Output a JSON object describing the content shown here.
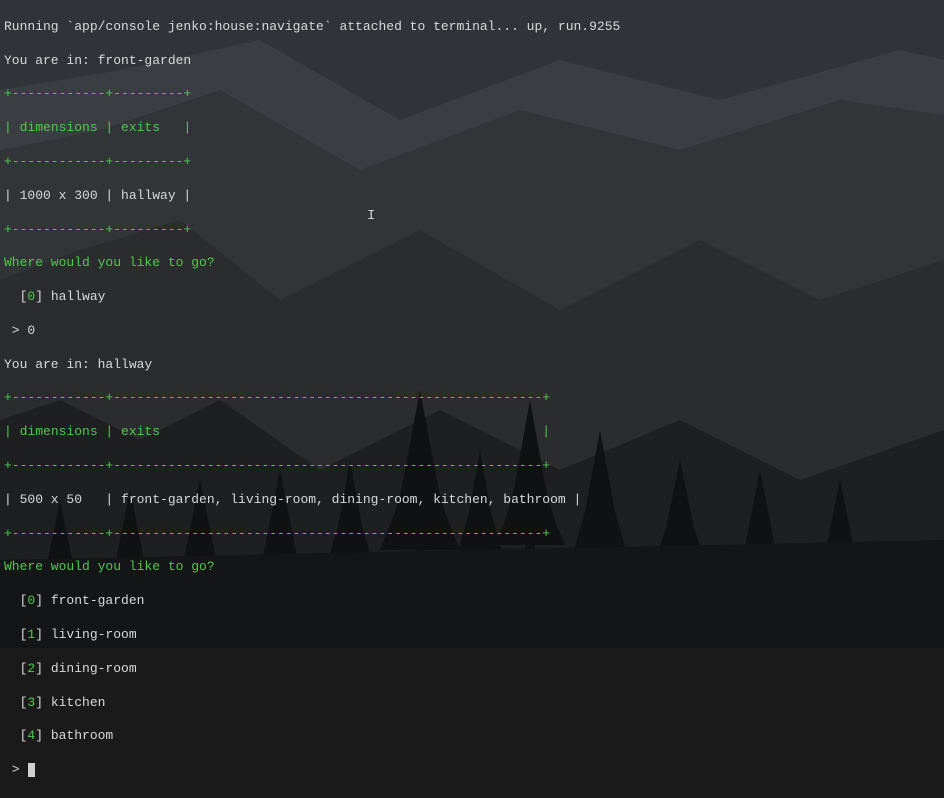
{
  "running_line": "Running `app/console jenko:house:navigate` attached to terminal... up, run.9255",
  "loc1": {
    "you_are_in": "You are in: front-garden",
    "border_top": "+------------+---------+",
    "header_pipe_open": "| ",
    "header_dim": "dimensions",
    "header_sep": " | ",
    "header_exits": "exits",
    "header_close": "   |",
    "border_mid": "+------------+---------+",
    "row": "| 1000 x 300 | hallway |",
    "border_bot": "+------------+---------+"
  },
  "prompt1": {
    "question": "Where would you like to go?",
    "opt0_bracket_open": "  [",
    "opt0_num": "0",
    "opt0_bracket_close": "] ",
    "opt0_label": "hallway",
    "answer_prefix": " > ",
    "answer": "0"
  },
  "loc2": {
    "you_are_in": "You are in: hallway",
    "border_top": "+------------+-------------------------------------------------------+",
    "header_pipe_open": "| ",
    "header_dim": "dimensions",
    "header_sep": " | ",
    "header_exits": "exits",
    "header_close": "                                                 |",
    "border_mid": "+------------+-------------------------------------------------------+",
    "row": "| 500 x 50   | front-garden, living-room, dining-room, kitchen, bathroom |",
    "border_bot": "+------------+-------------------------------------------------------+"
  },
  "prompt2": {
    "question": "Where would you like to go?",
    "opts": [
      {
        "num": "0",
        "label": "front-garden"
      },
      {
        "num": "1",
        "label": "living-room"
      },
      {
        "num": "2",
        "label": "dining-room"
      },
      {
        "num": "3",
        "label": "kitchen"
      },
      {
        "num": "4",
        "label": "bathroom"
      }
    ],
    "bracket_open": "  [",
    "bracket_close": "] ",
    "answer_prefix": " > "
  },
  "cursor_glyph": "I"
}
